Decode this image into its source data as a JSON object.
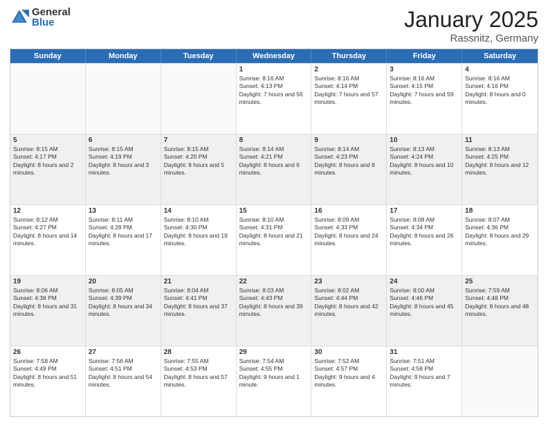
{
  "logo": {
    "general": "General",
    "blue": "Blue"
  },
  "title": {
    "month": "January 2025",
    "location": "Rassnitz, Germany"
  },
  "header": {
    "days": [
      "Sunday",
      "Monday",
      "Tuesday",
      "Wednesday",
      "Thursday",
      "Friday",
      "Saturday"
    ]
  },
  "weeks": [
    [
      {
        "day": "",
        "sunrise": "",
        "sunset": "",
        "daylight": "",
        "empty": true
      },
      {
        "day": "",
        "sunrise": "",
        "sunset": "",
        "daylight": "",
        "empty": true
      },
      {
        "day": "",
        "sunrise": "",
        "sunset": "",
        "daylight": "",
        "empty": true
      },
      {
        "day": "1",
        "sunrise": "Sunrise: 8:16 AM",
        "sunset": "Sunset: 4:13 PM",
        "daylight": "Daylight: 7 hours and 56 minutes."
      },
      {
        "day": "2",
        "sunrise": "Sunrise: 8:16 AM",
        "sunset": "Sunset: 4:14 PM",
        "daylight": "Daylight: 7 hours and 57 minutes."
      },
      {
        "day": "3",
        "sunrise": "Sunrise: 8:16 AM",
        "sunset": "Sunset: 4:15 PM",
        "daylight": "Daylight: 7 hours and 59 minutes."
      },
      {
        "day": "4",
        "sunrise": "Sunrise: 8:16 AM",
        "sunset": "Sunset: 4:16 PM",
        "daylight": "Daylight: 8 hours and 0 minutes."
      }
    ],
    [
      {
        "day": "5",
        "sunrise": "Sunrise: 8:15 AM",
        "sunset": "Sunset: 4:17 PM",
        "daylight": "Daylight: 8 hours and 2 minutes."
      },
      {
        "day": "6",
        "sunrise": "Sunrise: 8:15 AM",
        "sunset": "Sunset: 4:19 PM",
        "daylight": "Daylight: 8 hours and 3 minutes."
      },
      {
        "day": "7",
        "sunrise": "Sunrise: 8:15 AM",
        "sunset": "Sunset: 4:20 PM",
        "daylight": "Daylight: 8 hours and 5 minutes."
      },
      {
        "day": "8",
        "sunrise": "Sunrise: 8:14 AM",
        "sunset": "Sunset: 4:21 PM",
        "daylight": "Daylight: 8 hours and 6 minutes."
      },
      {
        "day": "9",
        "sunrise": "Sunrise: 8:14 AM",
        "sunset": "Sunset: 4:23 PM",
        "daylight": "Daylight: 8 hours and 8 minutes."
      },
      {
        "day": "10",
        "sunrise": "Sunrise: 8:13 AM",
        "sunset": "Sunset: 4:24 PM",
        "daylight": "Daylight: 8 hours and 10 minutes."
      },
      {
        "day": "11",
        "sunrise": "Sunrise: 8:13 AM",
        "sunset": "Sunset: 4:25 PM",
        "daylight": "Daylight: 8 hours and 12 minutes."
      }
    ],
    [
      {
        "day": "12",
        "sunrise": "Sunrise: 8:12 AM",
        "sunset": "Sunset: 4:27 PM",
        "daylight": "Daylight: 8 hours and 14 minutes."
      },
      {
        "day": "13",
        "sunrise": "Sunrise: 8:11 AM",
        "sunset": "Sunset: 4:28 PM",
        "daylight": "Daylight: 8 hours and 17 minutes."
      },
      {
        "day": "14",
        "sunrise": "Sunrise: 8:10 AM",
        "sunset": "Sunset: 4:30 PM",
        "daylight": "Daylight: 8 hours and 19 minutes."
      },
      {
        "day": "15",
        "sunrise": "Sunrise: 8:10 AM",
        "sunset": "Sunset: 4:31 PM",
        "daylight": "Daylight: 8 hours and 21 minutes."
      },
      {
        "day": "16",
        "sunrise": "Sunrise: 8:09 AM",
        "sunset": "Sunset: 4:33 PM",
        "daylight": "Daylight: 8 hours and 24 minutes."
      },
      {
        "day": "17",
        "sunrise": "Sunrise: 8:08 AM",
        "sunset": "Sunset: 4:34 PM",
        "daylight": "Daylight: 8 hours and 26 minutes."
      },
      {
        "day": "18",
        "sunrise": "Sunrise: 8:07 AM",
        "sunset": "Sunset: 4:36 PM",
        "daylight": "Daylight: 8 hours and 29 minutes."
      }
    ],
    [
      {
        "day": "19",
        "sunrise": "Sunrise: 8:06 AM",
        "sunset": "Sunset: 4:38 PM",
        "daylight": "Daylight: 8 hours and 31 minutes."
      },
      {
        "day": "20",
        "sunrise": "Sunrise: 8:05 AM",
        "sunset": "Sunset: 4:39 PM",
        "daylight": "Daylight: 8 hours and 34 minutes."
      },
      {
        "day": "21",
        "sunrise": "Sunrise: 8:04 AM",
        "sunset": "Sunset: 4:41 PM",
        "daylight": "Daylight: 8 hours and 37 minutes."
      },
      {
        "day": "22",
        "sunrise": "Sunrise: 8:03 AM",
        "sunset": "Sunset: 4:43 PM",
        "daylight": "Daylight: 8 hours and 39 minutes."
      },
      {
        "day": "23",
        "sunrise": "Sunrise: 8:02 AM",
        "sunset": "Sunset: 4:44 PM",
        "daylight": "Daylight: 8 hours and 42 minutes."
      },
      {
        "day": "24",
        "sunrise": "Sunrise: 8:00 AM",
        "sunset": "Sunset: 4:46 PM",
        "daylight": "Daylight: 8 hours and 45 minutes."
      },
      {
        "day": "25",
        "sunrise": "Sunrise: 7:59 AM",
        "sunset": "Sunset: 4:48 PM",
        "daylight": "Daylight: 8 hours and 48 minutes."
      }
    ],
    [
      {
        "day": "26",
        "sunrise": "Sunrise: 7:58 AM",
        "sunset": "Sunset: 4:49 PM",
        "daylight": "Daylight: 8 hours and 51 minutes."
      },
      {
        "day": "27",
        "sunrise": "Sunrise: 7:56 AM",
        "sunset": "Sunset: 4:51 PM",
        "daylight": "Daylight: 8 hours and 54 minutes."
      },
      {
        "day": "28",
        "sunrise": "Sunrise: 7:55 AM",
        "sunset": "Sunset: 4:53 PM",
        "daylight": "Daylight: 8 hours and 57 minutes."
      },
      {
        "day": "29",
        "sunrise": "Sunrise: 7:54 AM",
        "sunset": "Sunset: 4:55 PM",
        "daylight": "Daylight: 9 hours and 1 minute."
      },
      {
        "day": "30",
        "sunrise": "Sunrise: 7:52 AM",
        "sunset": "Sunset: 4:57 PM",
        "daylight": "Daylight: 9 hours and 4 minutes."
      },
      {
        "day": "31",
        "sunrise": "Sunrise: 7:51 AM",
        "sunset": "Sunset: 4:58 PM",
        "daylight": "Daylight: 9 hours and 7 minutes."
      },
      {
        "day": "",
        "sunrise": "",
        "sunset": "",
        "daylight": "",
        "empty": true
      }
    ]
  ]
}
